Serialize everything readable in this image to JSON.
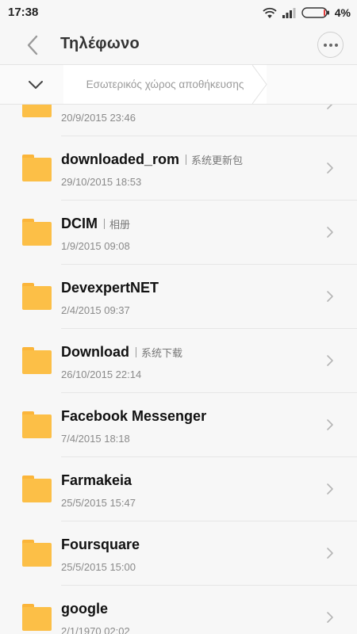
{
  "status_bar": {
    "time": "17:38",
    "battery": "4%"
  },
  "header": {
    "title": "Τηλέφωνο"
  },
  "breadcrumb": {
    "path": "Εσωτερικός χώρος αποθήκευσης"
  },
  "files": [
    {
      "name": "",
      "tag": "",
      "date": "20/9/2015 23:46"
    },
    {
      "name": "downloaded_rom",
      "tag": "系统更新包",
      "date": "29/10/2015 18:53"
    },
    {
      "name": "DCIM",
      "tag": "相册",
      "date": "1/9/2015 09:08"
    },
    {
      "name": "DevexpertNET",
      "tag": "",
      "date": "2/4/2015 09:37"
    },
    {
      "name": "Download",
      "tag": "系统下载",
      "date": "26/10/2015 22:14"
    },
    {
      "name": "Facebook Messenger",
      "tag": "",
      "date": "7/4/2015 18:18"
    },
    {
      "name": "Farmakeia",
      "tag": "",
      "date": "25/5/2015 15:47"
    },
    {
      "name": "Foursquare",
      "tag": "",
      "date": "25/5/2015 15:00"
    },
    {
      "name": "google",
      "tag": "",
      "date": "2/1/1970 02:02"
    }
  ]
}
